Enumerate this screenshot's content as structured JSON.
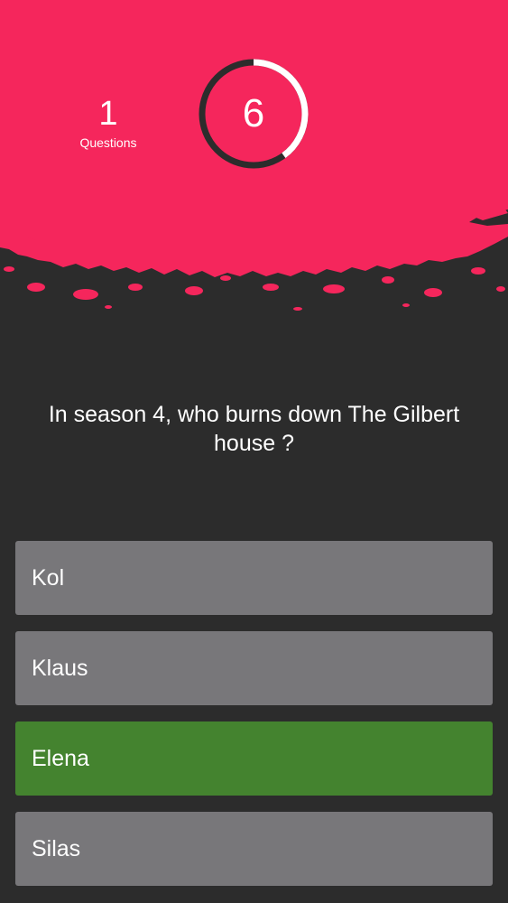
{
  "header": {
    "question_number": "1",
    "question_label": "Questions",
    "timer_value": "6",
    "timer_progress": 0.4,
    "colors": {
      "header_pink": "#f5265c",
      "dark_background": "#2c2c2c",
      "timer_ring_white": "#ffffff",
      "timer_ring_dark": "#2c2c2c"
    }
  },
  "question": {
    "text": "In season 4, who burns down The Gilbert house ?"
  },
  "answers": [
    {
      "label": "Kol",
      "state": "default"
    },
    {
      "label": "Klaus",
      "state": "default"
    },
    {
      "label": "Elena",
      "state": "correct"
    },
    {
      "label": "Silas",
      "state": "default"
    }
  ],
  "colors": {
    "answer_default": "#78777a",
    "answer_correct": "#44832f"
  }
}
